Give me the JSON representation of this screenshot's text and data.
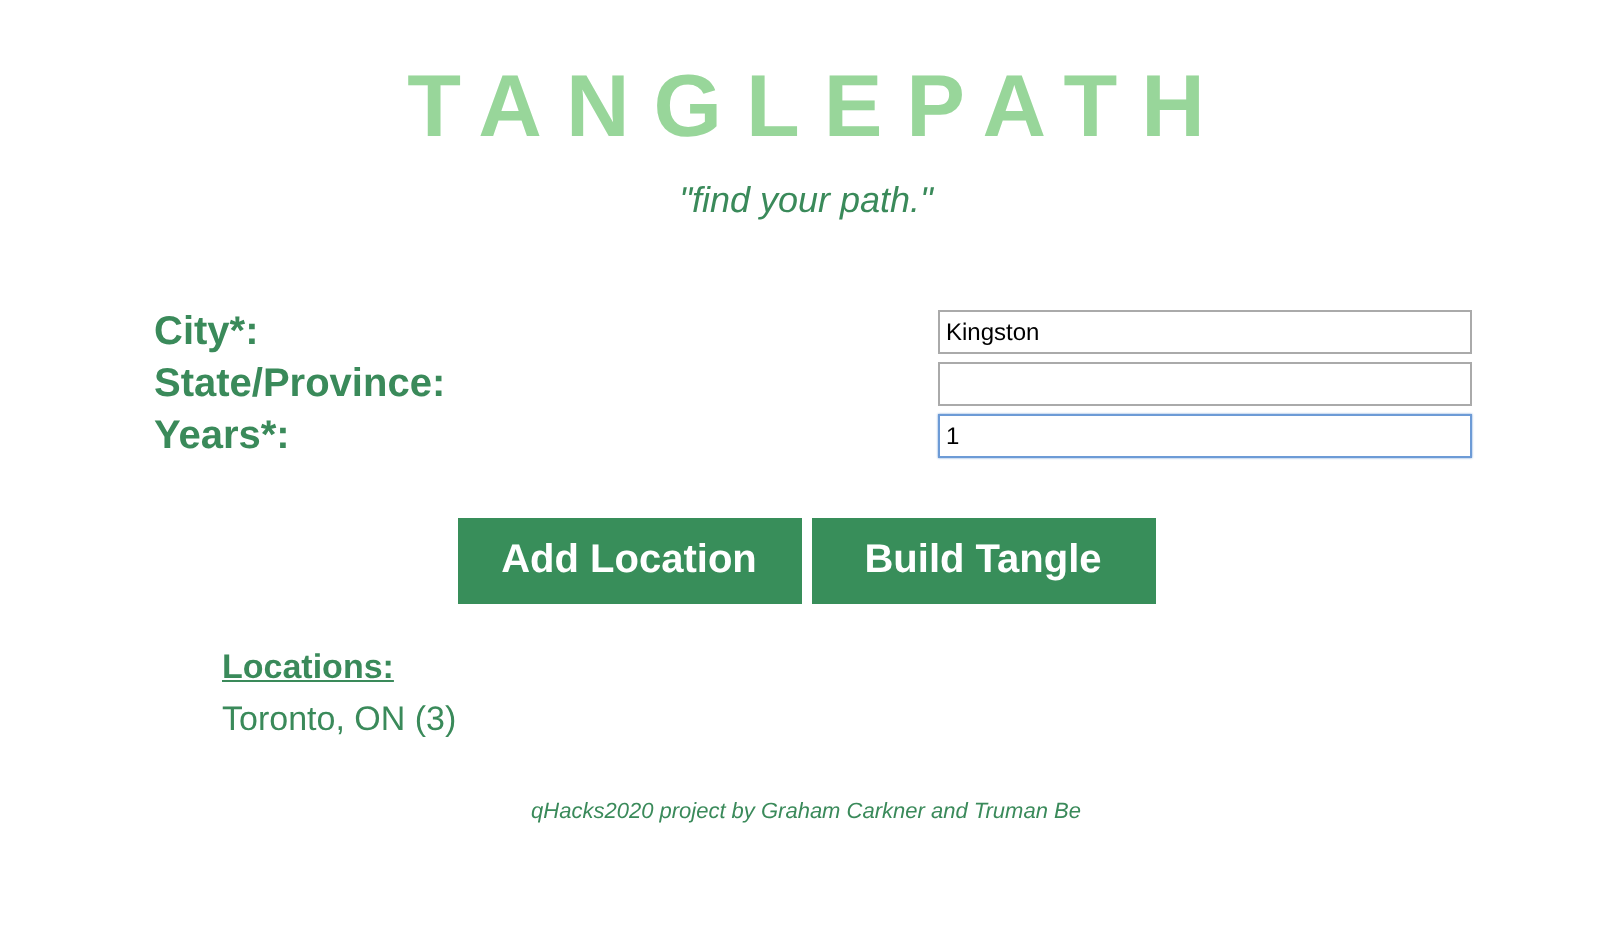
{
  "header": {
    "title": "TANGLEPATH",
    "tagline": "\"find your path.\""
  },
  "form": {
    "fields": [
      {
        "label": "City*:",
        "value": "Kingston",
        "focused": false
      },
      {
        "label": "State/Province:",
        "focused": false
      },
      {
        "label": "Years*:",
        "value": "1",
        "focused": true
      }
    ]
  },
  "buttons": [
    "Add Location",
    "Build Tangle"
  ],
  "locations": {
    "heading": "Locations:",
    "items": [
      "Toronto, ON (3)"
    ]
  },
  "footer": "qHacks2020 project by Graham Carkner and Truman Be"
}
